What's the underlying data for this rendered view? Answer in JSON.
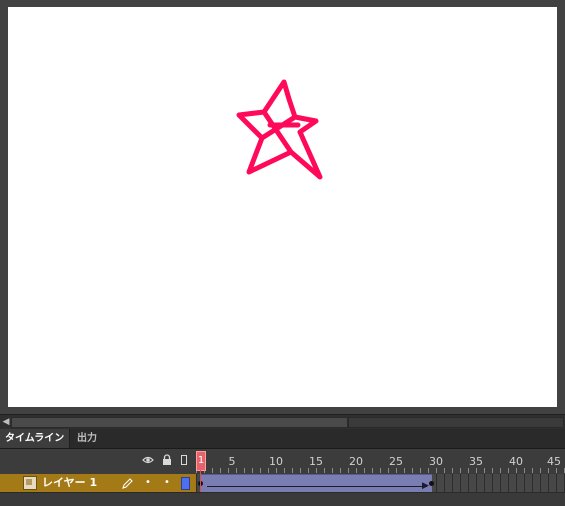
{
  "stage": {
    "star_color": "#ff0a5a",
    "background": "#ffffff"
  },
  "panel_tabs": [
    {
      "label": "タイムライン",
      "active": true
    },
    {
      "label": "出力",
      "active": false
    }
  ],
  "timeline": {
    "current_frame": "1",
    "ruler_labels": [
      "5",
      "10",
      "15",
      "20",
      "25",
      "30",
      "35",
      "40",
      "45"
    ],
    "header_icons": [
      "eye-icon",
      "lock-icon",
      "outline-icon"
    ],
    "layers": [
      {
        "name": "レイヤー 1",
        "outline_color": "#4d6ff0",
        "tween_start_frame": 1,
        "tween_end_frame": 30
      }
    ]
  }
}
